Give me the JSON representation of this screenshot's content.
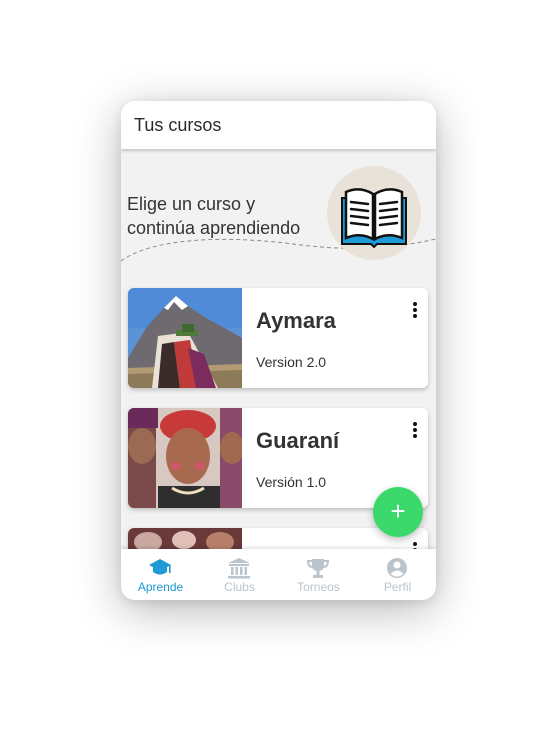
{
  "appbar": {
    "title": "Tus cursos"
  },
  "hero": {
    "line1": "Elige un curso y",
    "line2": "continúa aprendiendo",
    "icon": "open-book-icon"
  },
  "courses": [
    {
      "title": "Aymara",
      "version": "Version 2.0",
      "image": "andean-mountain-person-photo"
    },
    {
      "title": "Guaraní",
      "version": "Versión 1.0",
      "image": "indigenous-people-photo"
    },
    {
      "title": "",
      "version": "",
      "image": "indigenous-people-photo-2"
    }
  ],
  "fab": {
    "label": "+"
  },
  "bottom_nav": {
    "items": [
      {
        "label": "Aprende",
        "icon": "graduation-cap-icon",
        "active": true
      },
      {
        "label": "Clubs",
        "icon": "institution-icon",
        "active": false
      },
      {
        "label": "Torneos",
        "icon": "trophy-icon",
        "active": false
      },
      {
        "label": "Perfil",
        "icon": "user-circle-icon",
        "active": false
      }
    ]
  },
  "colors": {
    "accent": "#1e9ad6",
    "inactive": "#b9c4cc",
    "fab": "#3bd96b",
    "background": "#f2f2f2"
  }
}
